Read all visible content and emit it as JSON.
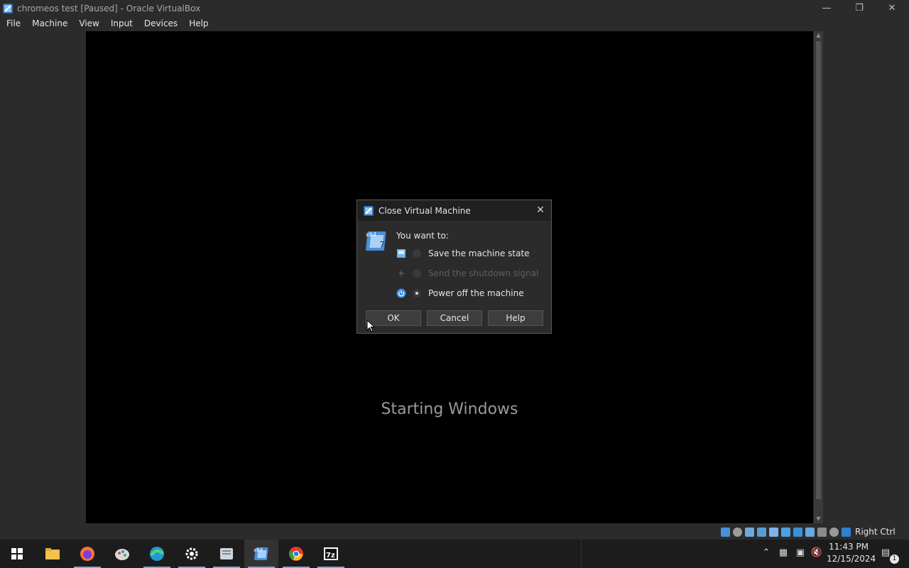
{
  "window": {
    "title": "chromeos test [Paused] - Oracle VirtualBox",
    "controls": [
      "minimize",
      "restore",
      "close"
    ]
  },
  "menu": [
    "File",
    "Machine",
    "View",
    "Input",
    "Devices",
    "Help"
  ],
  "vm": {
    "screen_text": "Starting Windows"
  },
  "statusbar": {
    "icons": [
      "hard-disk-icon",
      "optical-drive-icon",
      "audio-icon",
      "network-icon",
      "usb-icon",
      "shared-folder-icon",
      "display-icon",
      "recording-icon",
      "virtualization-icon",
      "cpu-icon",
      "mouse-integration-icon",
      "keyboard-icon"
    ],
    "host_key": "Right Ctrl"
  },
  "dialog": {
    "title": "Close Virtual Machine",
    "prompt": "You want to:",
    "options": [
      {
        "label": "Save the machine state",
        "selected": false,
        "enabled": true,
        "icon": "save-state-icon"
      },
      {
        "label": "Send the shutdown signal",
        "selected": false,
        "enabled": false,
        "icon": "shutdown-signal-icon"
      },
      {
        "label": "Power off the machine",
        "selected": true,
        "enabled": true,
        "icon": "power-icon"
      }
    ],
    "buttons": {
      "ok": "OK",
      "cancel": "Cancel",
      "help": "Help"
    }
  },
  "taskbar": {
    "apps": [
      "start-icon",
      "file-explorer-icon",
      "firefox-icon",
      "paint-icon",
      "edge-icon",
      "settings-icon",
      "documents-icon",
      "virtualbox-icon",
      "chrome-icon",
      "7zip-icon"
    ],
    "clock_time": "11:43 PM",
    "clock_date": "12/15/2024",
    "notification_count": "1"
  },
  "colors": {
    "background": "#2b2b2b",
    "vm_screen": "#000000",
    "taskbar": "#1c1c1c",
    "accent": "#7aa7e6"
  }
}
